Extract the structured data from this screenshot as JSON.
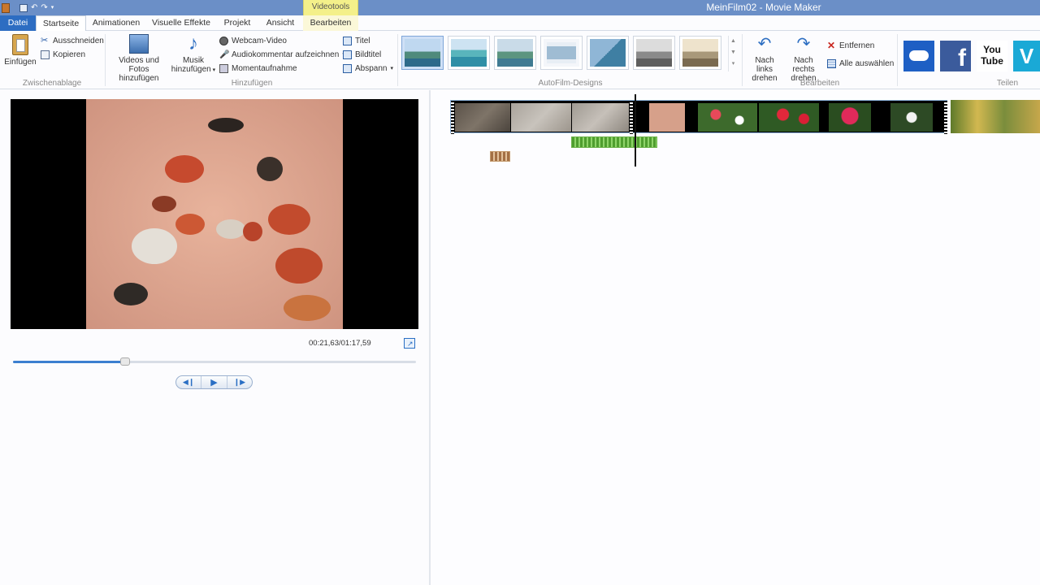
{
  "window": {
    "title": "MeinFilm02 - Movie Maker",
    "context_tab_group": "Videotools"
  },
  "tabs": [
    {
      "label": "Datei"
    },
    {
      "label": "Startseite"
    },
    {
      "label": "Animationen"
    },
    {
      "label": "Visuelle Effekte"
    },
    {
      "label": "Projekt"
    },
    {
      "label": "Ansicht"
    },
    {
      "label": "Bearbeiten"
    }
  ],
  "ribbon": {
    "clipboard": {
      "paste": "Einfügen",
      "cut": "Ausschneiden",
      "copy": "Kopieren",
      "group": "Zwischenablage"
    },
    "add": {
      "videos_line1": "Videos und Fotos",
      "videos_line2": "hinzufügen",
      "music_line1": "Musik",
      "music_line2": "hinzufügen",
      "webcam": "Webcam-Video",
      "narration": "Audiokommentar aufzeichnen",
      "snapshot": "Momentaufnahme",
      "title": "Titel",
      "caption": "Bildtitel",
      "credits": "Abspann",
      "group": "Hinzufügen"
    },
    "autofilm": {
      "group": "AutoFilm-Designs"
    },
    "editing": {
      "rotate_left_line1": "Nach links",
      "rotate_left_line2": "drehen",
      "rotate_right_line1": "Nach rechts",
      "rotate_right_line2": "drehen",
      "remove": "Entfernen",
      "select_all": "Alle auswählen",
      "group": "Bearbeiten"
    },
    "share": {
      "group": "Teilen",
      "youtube": "You Tube"
    }
  },
  "preview": {
    "timecode": "00:21,63/01:17,59",
    "progress_fraction": 0.279
  },
  "colors": {
    "title_bar": "#6b8fc7",
    "file_tab": "#2d6dc2",
    "context_tab": "#f4f08a",
    "accent": "#3c7fd0"
  }
}
